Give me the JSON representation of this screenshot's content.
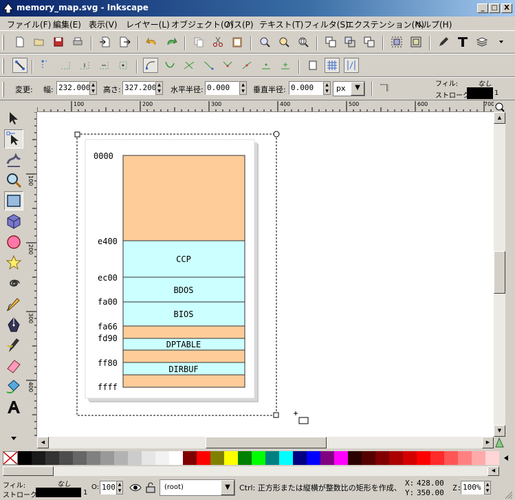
{
  "window": {
    "title": "memory_map.svg - Inkscape",
    "minimize": "_",
    "maximize": "□",
    "close": "X"
  },
  "menu": [
    "ファイル(F)",
    "編集(E)",
    "表示(V)",
    "レイヤー(L)",
    "オブジェクト(O)",
    "パス(P)",
    "テキスト(T)",
    "フィルタ(S)",
    "エクステンション(N)",
    "ヘルプ(H)"
  ],
  "controls": {
    "change_label": "変更:",
    "width_label": "幅:",
    "width_value": "232.000",
    "height_label": "高さ:",
    "height_value": "327.200",
    "rx_label": "水平半径:",
    "rx_value": "0.000",
    "ry_label": "垂直半径:",
    "ry_value": "0.000",
    "unit": "px"
  },
  "fill_stroke_top": {
    "fill_label": "フィル:",
    "fill_value": "なし",
    "stroke_label": "ストローク:",
    "stroke_width": "1"
  },
  "rulers": {
    "h": [
      "100",
      "200",
      "300",
      "400",
      "500",
      "600",
      "700"
    ],
    "v": [
      "100",
      "200",
      "300",
      "400"
    ]
  },
  "memory_map": {
    "labels": [
      "0000",
      "e400",
      "ec00",
      "fa00",
      "fa66",
      "fd90",
      "ff80",
      "ffff"
    ],
    "blocks": [
      "CCP",
      "BDOS",
      "BIOS",
      "DPTABLE",
      "DIRBUF"
    ]
  },
  "status": {
    "fill_label": "フィル:",
    "fill_value": "なし",
    "stroke_label": "ストローク:",
    "stroke_width": "1",
    "opacity_label": "O:",
    "opacity_value": "100",
    "layer": "(root)",
    "message": "Ctrl: 正方形または縦横が整数比の矩形を作成、",
    "x_label": "X:",
    "x_value": "428.00",
    "y_label": "Y:",
    "y_value": "350.00",
    "zoom_label": "Z:",
    "zoom_value": "100%"
  },
  "colors": {
    "peach": "#fdcc99",
    "cyan": "#ccffff",
    "palette": [
      "#000000",
      "#1a1a1a",
      "#333333",
      "#4d4d4d",
      "#666666",
      "#808080",
      "#999999",
      "#b3b3b3",
      "#cccccc",
      "#e6e6e6",
      "#f2f2f2",
      "#ffffff",
      "#800000",
      "#ff0000",
      "#808000",
      "#ffff00",
      "#008000",
      "#00ff00",
      "#008080",
      "#00ffff",
      "#000080",
      "#0000ff",
      "#800080",
      "#ff00ff",
      "#2b0000",
      "#550000",
      "#800000",
      "#aa0000",
      "#d40000",
      "#ff0000",
      "#ff2a2a",
      "#ff5555",
      "#ff8080",
      "#ffaaaa",
      "#ffd5d5"
    ]
  }
}
